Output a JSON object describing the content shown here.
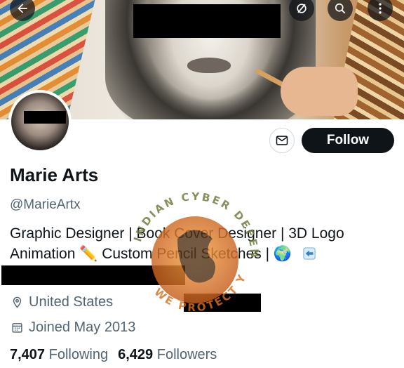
{
  "header": {
    "back_icon": "arrow-left-icon",
    "actions": [
      "hide-icon",
      "search-icon",
      "more-vertical-icon"
    ]
  },
  "profile": {
    "name": "Marie Arts",
    "handle": "@MarieArtx",
    "bio_line1": "Graphic Designer | Book Cover Designer | 3D Logo",
    "bio_line2_text": "Animation ✏️ Custom Pencil Sketches | 🌍",
    "location": "United States",
    "joined": "Joined May 2013",
    "following_count": "7,407",
    "following_label": "Following",
    "followers_count": "6,429",
    "followers_label": "Followers"
  },
  "buttons": {
    "message_icon": "mail-icon",
    "follow_label": "Follow"
  },
  "watermark": {
    "top_text": "INDIAN CYBER DEFENDER",
    "bottom_text": "WE PROTECT YOU"
  },
  "colors": {
    "text_primary": "#0f1419",
    "text_secondary": "#536471",
    "follow_bg": "#0f1419",
    "watermark_orange": "#d9701f"
  }
}
